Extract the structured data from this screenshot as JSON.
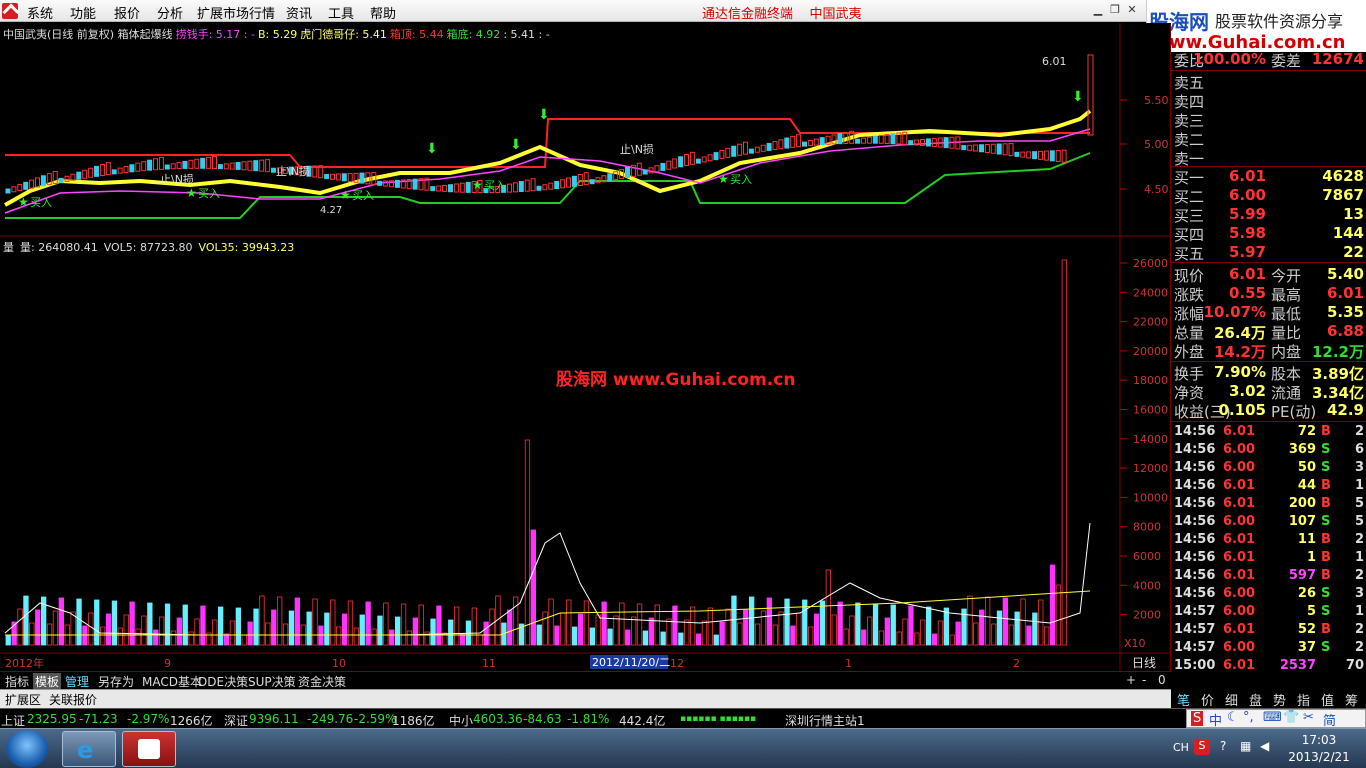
{
  "menu": {
    "items": [
      "系统",
      "功能",
      "报价",
      "分析",
      "扩展市场行情",
      "资讯",
      "工具",
      "帮助"
    ],
    "center_title": "通达信金融终端    中国武夷"
  },
  "logo": {
    "main": "股海网",
    "sub": "股票软件资源分享",
    "url": "Www.Guhai.com.cn"
  },
  "chart": {
    "info": [
      {
        "text": "中国武夷(日线 前复权) 箱体起爆线",
        "color": "#dddddd"
      },
      {
        "text": "捞钱手: 5.17 : -",
        "color": "#ff44ff"
      },
      {
        "text": "B: 5.29",
        "color": "#ffff66"
      },
      {
        "text": "虎门德哥仔: 5.41",
        "color": "#ffff66"
      },
      {
        "text": "箱顶: 5.44",
        "color": "#ff3333"
      },
      {
        "text": "箱底: 4.92",
        "color": "#33dd33"
      },
      {
        "text": ": 5.41 : -",
        "color": "#dddddd"
      }
    ],
    "price_axis": [
      "5.50",
      "5.00",
      "4.50"
    ],
    "max_label": "6.01",
    "min_label": "4.27",
    "annotations": [
      "止\\N损",
      "止\\N损",
      "止\\N损",
      "买入",
      "买入",
      "买入",
      "买入",
      "买入"
    ],
    "vol_line": [
      {
        "text": "量",
        "color": "#dddddd"
      },
      {
        "text": "量: 264080.41",
        "color": "#dddddd"
      },
      {
        "text": "VOL5: 87723.80",
        "color": "#dddddd"
      },
      {
        "text": "VOL35: 39943.23",
        "color": "#ffff66"
      }
    ],
    "vol_axis": [
      "26000",
      "24000",
      "22000",
      "20000",
      "18000",
      "16000",
      "14000",
      "12000",
      "10000",
      "8000",
      "6000",
      "4000",
      "2000"
    ],
    "x10": "X10",
    "date_axis": [
      "2012年",
      "9",
      "10",
      "11",
      "12",
      "1",
      "2"
    ],
    "cursor_date": "2012/11/20/二",
    "watermark": "股海网   www.Guhai.com.cn",
    "period": "日线"
  },
  "panel": {
    "top": {
      "label": "委比",
      "value": "100.00%",
      "label2": "委差",
      "value2": "12674"
    },
    "sell": [
      {
        "label": "卖五",
        "price": "",
        "vol": ""
      },
      {
        "label": "卖四",
        "price": "",
        "vol": ""
      },
      {
        "label": "卖三",
        "price": "",
        "vol": ""
      },
      {
        "label": "卖二",
        "price": "",
        "vol": ""
      },
      {
        "label": "卖一",
        "price": "",
        "vol": ""
      }
    ],
    "buy": [
      {
        "label": "买一",
        "price": "6.01",
        "vol": "4628"
      },
      {
        "label": "买二",
        "price": "6.00",
        "vol": "7867"
      },
      {
        "label": "买三",
        "price": "5.99",
        "vol": "13"
      },
      {
        "label": "买四",
        "price": "5.98",
        "vol": "144"
      },
      {
        "label": "买五",
        "price": "5.97",
        "vol": "22"
      }
    ],
    "stats": [
      {
        "l1": "现价",
        "v1": "6.01",
        "c1": "#ff3333",
        "l2": "今开",
        "v2": "5.40",
        "c2": "#ffff66"
      },
      {
        "l1": "涨跌",
        "v1": "0.55",
        "c1": "#ff3333",
        "l2": "最高",
        "v2": "6.01",
        "c2": "#ff3333"
      },
      {
        "l1": "涨幅",
        "v1": "10.07%",
        "c1": "#ff3333",
        "l2": "最低",
        "v2": "5.35",
        "c2": "#ffff66"
      },
      {
        "l1": "总量",
        "v1": "26.4万",
        "c1": "#ffff66",
        "l2": "量比",
        "v2": "6.88",
        "c2": "#ff3333"
      },
      {
        "l1": "外盘",
        "v1": "14.2万",
        "c1": "#ff3333",
        "l2": "内盘",
        "v2": "12.2万",
        "c2": "#33dd33"
      },
      {
        "l1": "换手",
        "v1": "7.90%",
        "c1": "#ffff66",
        "l2": "股本",
        "v2": "3.89亿",
        "c2": "#ffff66"
      },
      {
        "l1": "净资",
        "v1": "3.02",
        "c1": "#ffff66",
        "l2": "流通",
        "v2": "3.34亿",
        "c2": "#ffff66"
      },
      {
        "l1": "收益(三)",
        "v1": "0.105",
        "c1": "#ffff66",
        "l2": "PE(动)",
        "v2": "42.9",
        "c2": "#ffff66"
      }
    ],
    "ticks": [
      {
        "t": "14:56",
        "p": "6.01",
        "v": "72",
        "s": "B",
        "n": "2"
      },
      {
        "t": "14:56",
        "p": "6.00",
        "v": "369",
        "s": "S",
        "n": "6"
      },
      {
        "t": "14:56",
        "p": "6.00",
        "v": "50",
        "s": "S",
        "n": "3"
      },
      {
        "t": "14:56",
        "p": "6.01",
        "v": "44",
        "s": "B",
        "n": "1"
      },
      {
        "t": "14:56",
        "p": "6.01",
        "v": "200",
        "s": "B",
        "n": "5"
      },
      {
        "t": "14:56",
        "p": "6.00",
        "v": "107",
        "s": "S",
        "n": "5"
      },
      {
        "t": "14:56",
        "p": "6.01",
        "v": "11",
        "s": "B",
        "n": "2"
      },
      {
        "t": "14:56",
        "p": "6.01",
        "v": "1",
        "s": "B",
        "n": "1"
      },
      {
        "t": "14:56",
        "p": "6.01",
        "v": "597",
        "s": "B",
        "n": "2"
      },
      {
        "t": "14:56",
        "p": "6.00",
        "v": "26",
        "s": "S",
        "n": "3"
      },
      {
        "t": "14:57",
        "p": "6.00",
        "v": "5",
        "s": "S",
        "n": "1"
      },
      {
        "t": "14:57",
        "p": "6.01",
        "v": "52",
        "s": "B",
        "n": "2"
      },
      {
        "t": "14:57",
        "p": "6.00",
        "v": "37",
        "s": "S",
        "n": "2"
      },
      {
        "t": "15:00",
        "p": "6.01",
        "v": "2537",
        "s": "",
        "n": "70"
      }
    ]
  },
  "tabs": [
    "指标",
    "模板",
    "管理",
    "另存为",
    "MACD基本",
    "DDE决策",
    "SUP决策",
    "资金决策"
  ],
  "tab_controls": [
    "+",
    "-",
    "0"
  ],
  "tabs2": [
    "扩展区",
    "关联报价"
  ],
  "side_tabs": [
    "笔",
    "价",
    "细",
    "盘",
    "势",
    "指",
    "值",
    "筹"
  ],
  "status": [
    {
      "text": "上证",
      "color": "#dddddd"
    },
    {
      "text": "2325.95",
      "color": "#33dd33"
    },
    {
      "text": "-71.23",
      "color": "#33dd33"
    },
    {
      "text": "-2.97%",
      "color": "#33dd33"
    },
    {
      "text": "1266亿",
      "color": "#dddddd"
    },
    {
      "text": "深证",
      "color": "#dddddd"
    },
    {
      "text": "9396.11",
      "color": "#33dd33"
    },
    {
      "text": "-249.76",
      "color": "#33dd33"
    },
    {
      "text": "-2.59%",
      "color": "#33dd33"
    },
    {
      "text": "1186亿",
      "color": "#dddddd"
    },
    {
      "text": "中小",
      "color": "#dddddd"
    },
    {
      "text": "4603.36",
      "color": "#33dd33"
    },
    {
      "text": "-84.63",
      "color": "#33dd33"
    },
    {
      "text": "-1.81%",
      "color": "#33dd33"
    },
    {
      "text": "442.4亿",
      "color": "#dddddd"
    },
    {
      "text": "深圳行情主站1",
      "color": "#dddddd"
    }
  ],
  "ime": [
    "S",
    "中",
    "简"
  ],
  "taskbar": {
    "lang": "CH",
    "time": "17:03",
    "date": "2013/2/21"
  }
}
